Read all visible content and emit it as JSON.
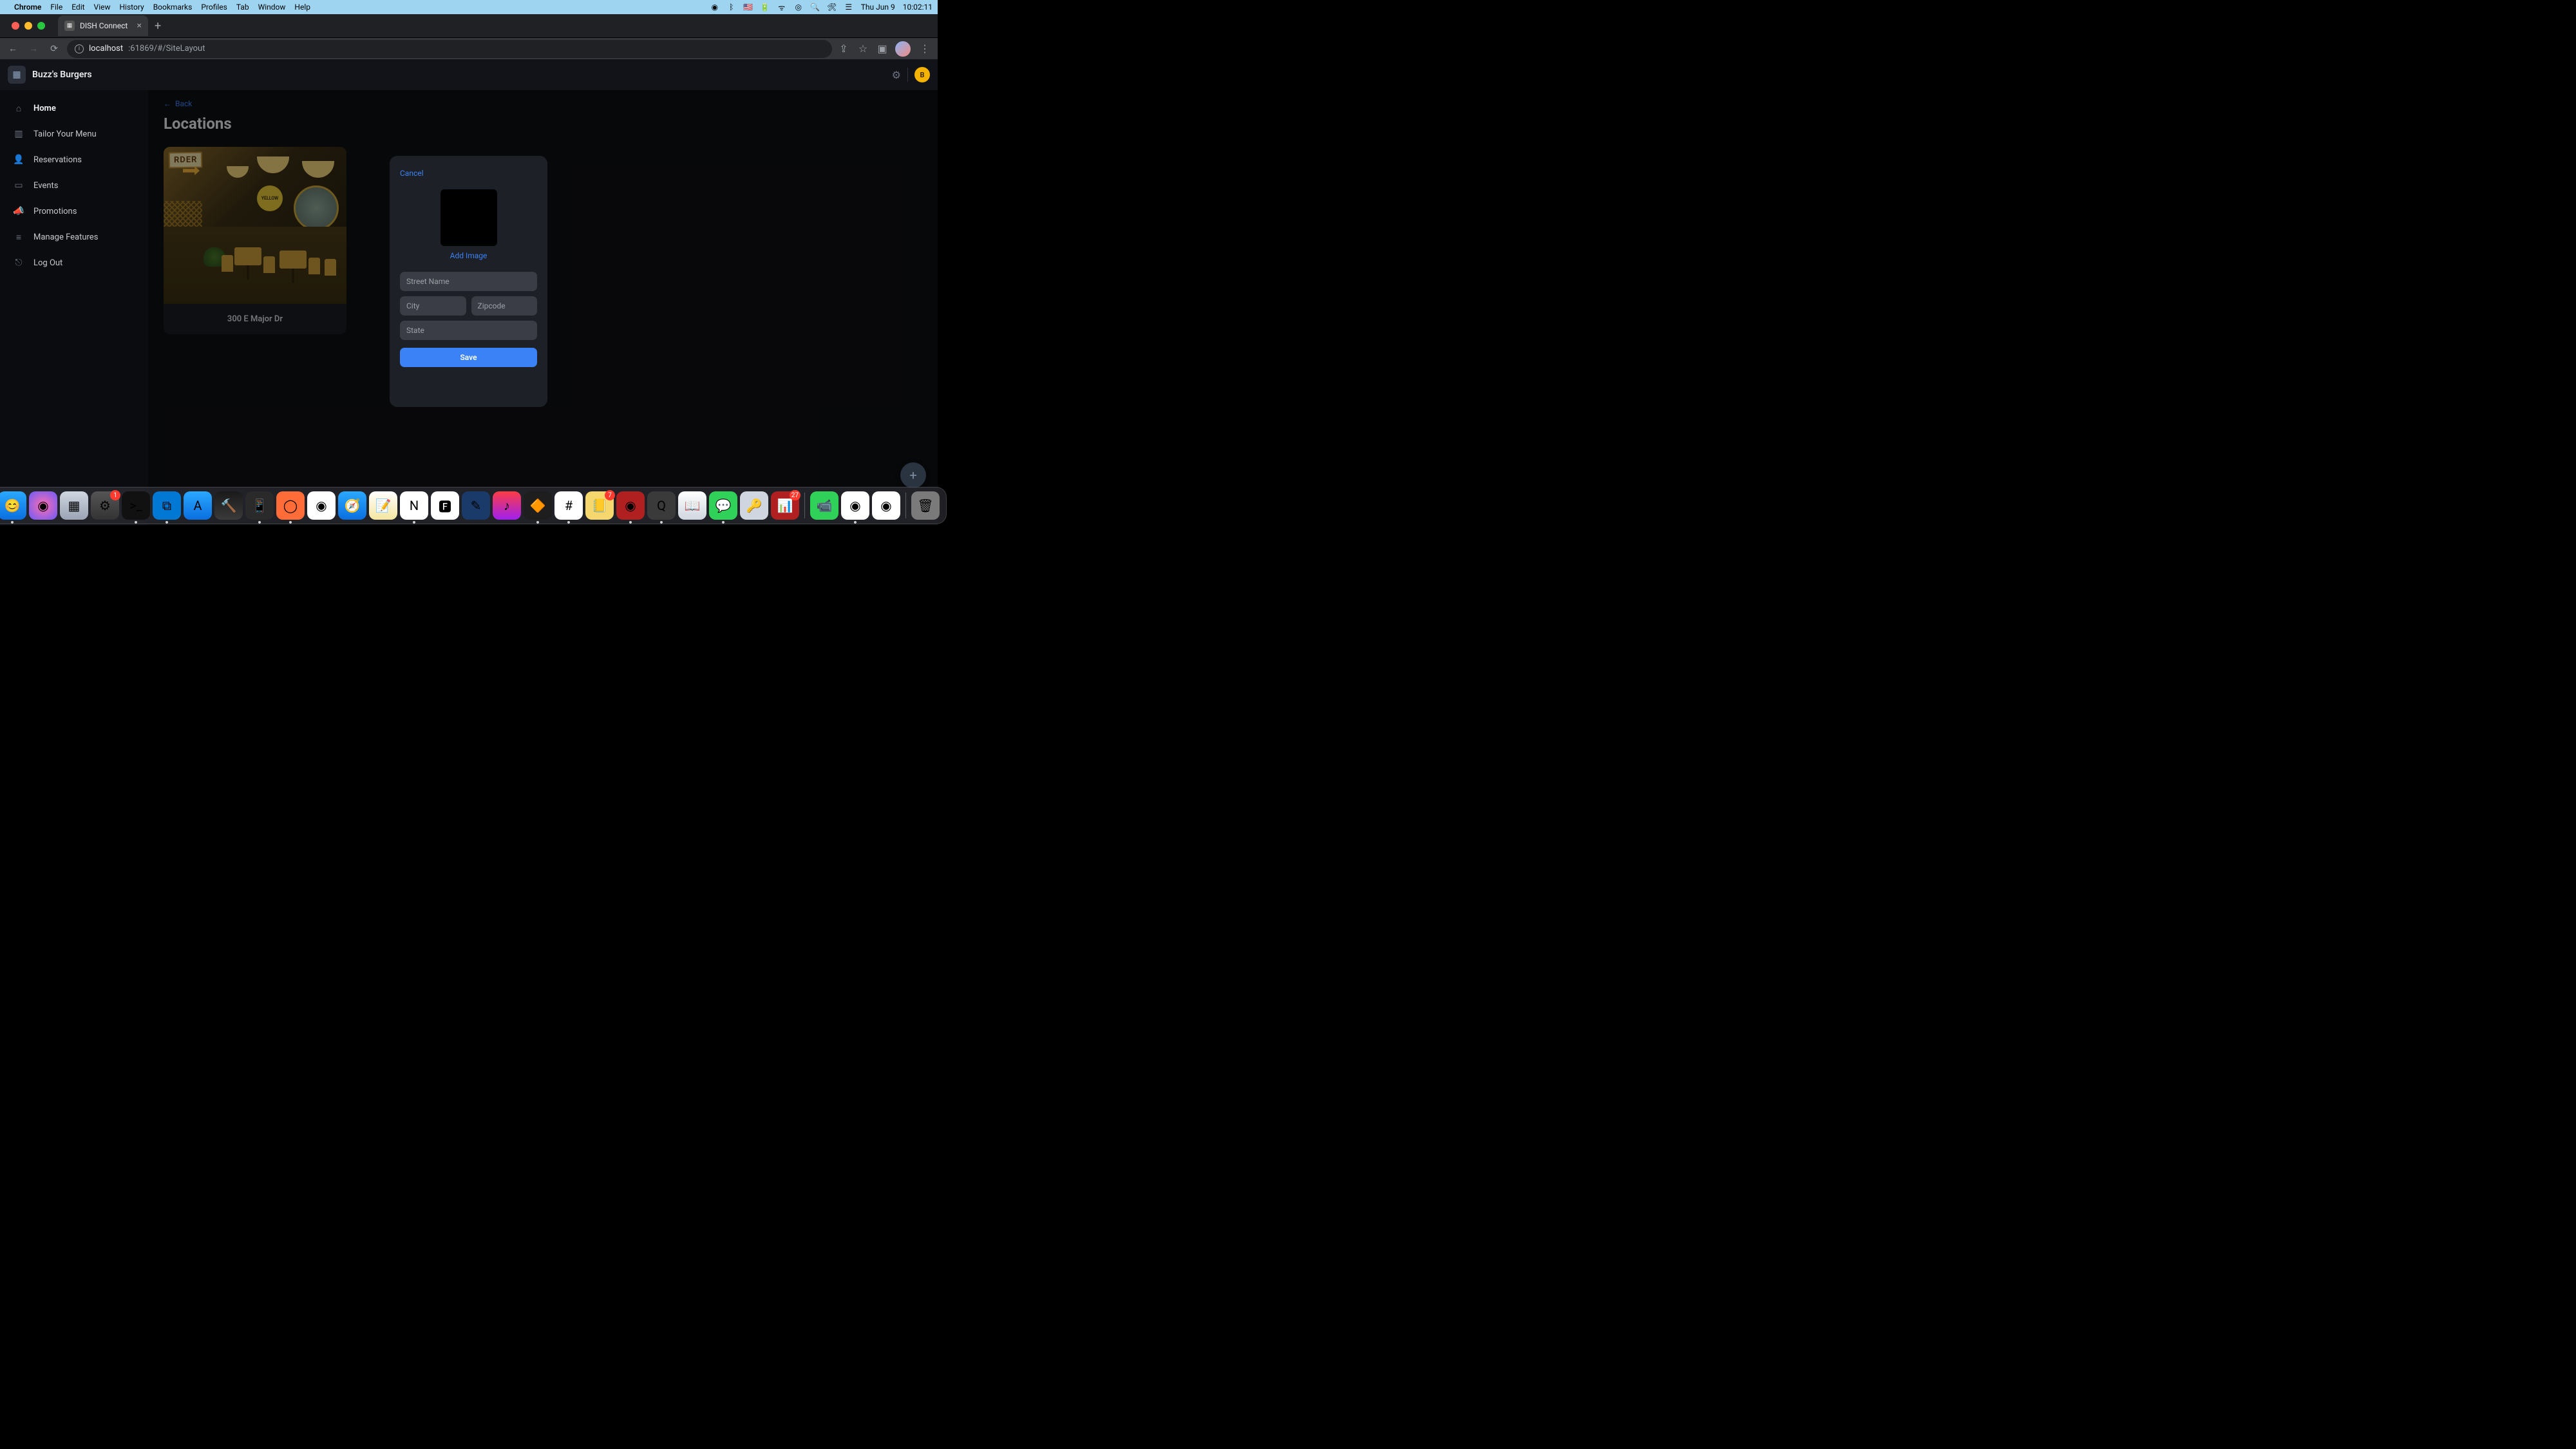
{
  "mac": {
    "app": "Chrome",
    "menus": [
      "File",
      "Edit",
      "View",
      "History",
      "Bookmarks",
      "Profiles",
      "Tab",
      "Window",
      "Help"
    ],
    "date": "Thu Jun 9",
    "time": "10:02:11"
  },
  "browser": {
    "tab_title": "DISH Connect",
    "url_host": "localhost",
    "url_port_path": ":61869/#/SiteLayout"
  },
  "app_header": {
    "title": "Buzz's Burgers",
    "profile_initial": "B"
  },
  "sidebar": {
    "items": [
      {
        "icon": "home",
        "label": "Home",
        "active": true
      },
      {
        "icon": "book",
        "label": "Tailor Your Menu"
      },
      {
        "icon": "person",
        "label": "Reservations"
      },
      {
        "icon": "calendar",
        "label": "Events"
      },
      {
        "icon": "megaphone",
        "label": "Promotions"
      },
      {
        "icon": "sliders",
        "label": "Manage Features"
      },
      {
        "icon": "logout",
        "label": "Log Out"
      }
    ]
  },
  "page": {
    "back_label": "Back",
    "title": "Locations"
  },
  "location_card": {
    "sign_text": "RDER",
    "badge_text": "YELLOW",
    "address": "300 E Major Dr"
  },
  "modal": {
    "cancel_label": "Cancel",
    "add_image_label": "Add Image",
    "street_placeholder": "Street Name",
    "city_placeholder": "City",
    "zip_placeholder": "Zipcode",
    "state_placeholder": "State",
    "save_label": "Save"
  },
  "fab": {
    "plus": "+"
  },
  "dock": {
    "icons": [
      {
        "name": "finder",
        "bg": "linear-gradient(#2aa8ff,#0a6fe0)",
        "glyph": "😊",
        "running": true
      },
      {
        "name": "siri",
        "bg": "radial-gradient(circle,#ff6fb0,#6a5af9)",
        "glyph": "◉"
      },
      {
        "name": "launchpad",
        "bg": "linear-gradient(#d0d6e0,#9aa4b5)",
        "glyph": "▦"
      },
      {
        "name": "settings",
        "bg": "linear-gradient(#555,#333)",
        "glyph": "⚙",
        "badge": "1"
      },
      {
        "name": "terminal",
        "bg": "#111",
        "glyph": ">_",
        "running": true
      },
      {
        "name": "vscode",
        "bg": "#0078d4",
        "glyph": "⧉",
        "running": true
      },
      {
        "name": "appstore",
        "bg": "linear-gradient(#2aa8ff,#0a6fe0)",
        "glyph": "A"
      },
      {
        "name": "xcode",
        "bg": "linear-gradient(#1a1a1a,#3a3a3a)",
        "glyph": "🔨"
      },
      {
        "name": "simulator",
        "bg": "#2a2a2a",
        "glyph": "📱",
        "running": true
      },
      {
        "name": "postman",
        "bg": "#ff6c37",
        "glyph": "◯",
        "running": true
      },
      {
        "name": "chrome-canary",
        "bg": "#fff",
        "glyph": "◉"
      },
      {
        "name": "safari",
        "bg": "linear-gradient(#2aa8ff,#0a6fe0)",
        "glyph": "🧭"
      },
      {
        "name": "notes",
        "bg": "linear-gradient(#fff,#f5e6a0)",
        "glyph": "📝"
      },
      {
        "name": "notion",
        "bg": "#fff",
        "glyph": "N",
        "running": true
      },
      {
        "name": "font",
        "bg": "#fff",
        "glyph": "🅵"
      },
      {
        "name": "sketch",
        "bg": "#1a3a6a",
        "glyph": "✎"
      },
      {
        "name": "music",
        "bg": "linear-gradient(#fc3c44,#a020f0)",
        "glyph": "♪"
      },
      {
        "name": "figma",
        "bg": "#1e1e1e",
        "glyph": "🔶",
        "running": true
      },
      {
        "name": "slack",
        "bg": "#fff",
        "glyph": "#",
        "running": true
      },
      {
        "name": "stickies",
        "bg": "#f5d76e",
        "glyph": "📒",
        "badge": "7"
      },
      {
        "name": "compass",
        "bg": "#b02020",
        "glyph": "◉",
        "running": true
      },
      {
        "name": "quicktime",
        "bg": "#3a3a3a",
        "glyph": "Q",
        "running": true
      },
      {
        "name": "dictionary",
        "bg": "linear-gradient(#fff,#d0d6e0)",
        "glyph": "📖"
      },
      {
        "name": "messages",
        "bg": "#30d158",
        "glyph": "💬",
        "running": true
      },
      {
        "name": "keychain",
        "bg": "#d0d6e0",
        "glyph": "🔑"
      },
      {
        "name": "numbers",
        "bg": "#b02020",
        "glyph": "📊",
        "badge": "27"
      },
      {
        "name": "sep",
        "sep": true
      },
      {
        "name": "facetime",
        "bg": "#30d158",
        "glyph": "📹"
      },
      {
        "name": "chrome",
        "bg": "#fff",
        "glyph": "◉",
        "running": true
      },
      {
        "name": "chrome2",
        "bg": "#fff",
        "glyph": "◉"
      },
      {
        "name": "sep2",
        "sep": true
      },
      {
        "name": "trash",
        "bg": "#7a7a7a",
        "glyph": "🗑"
      }
    ]
  }
}
